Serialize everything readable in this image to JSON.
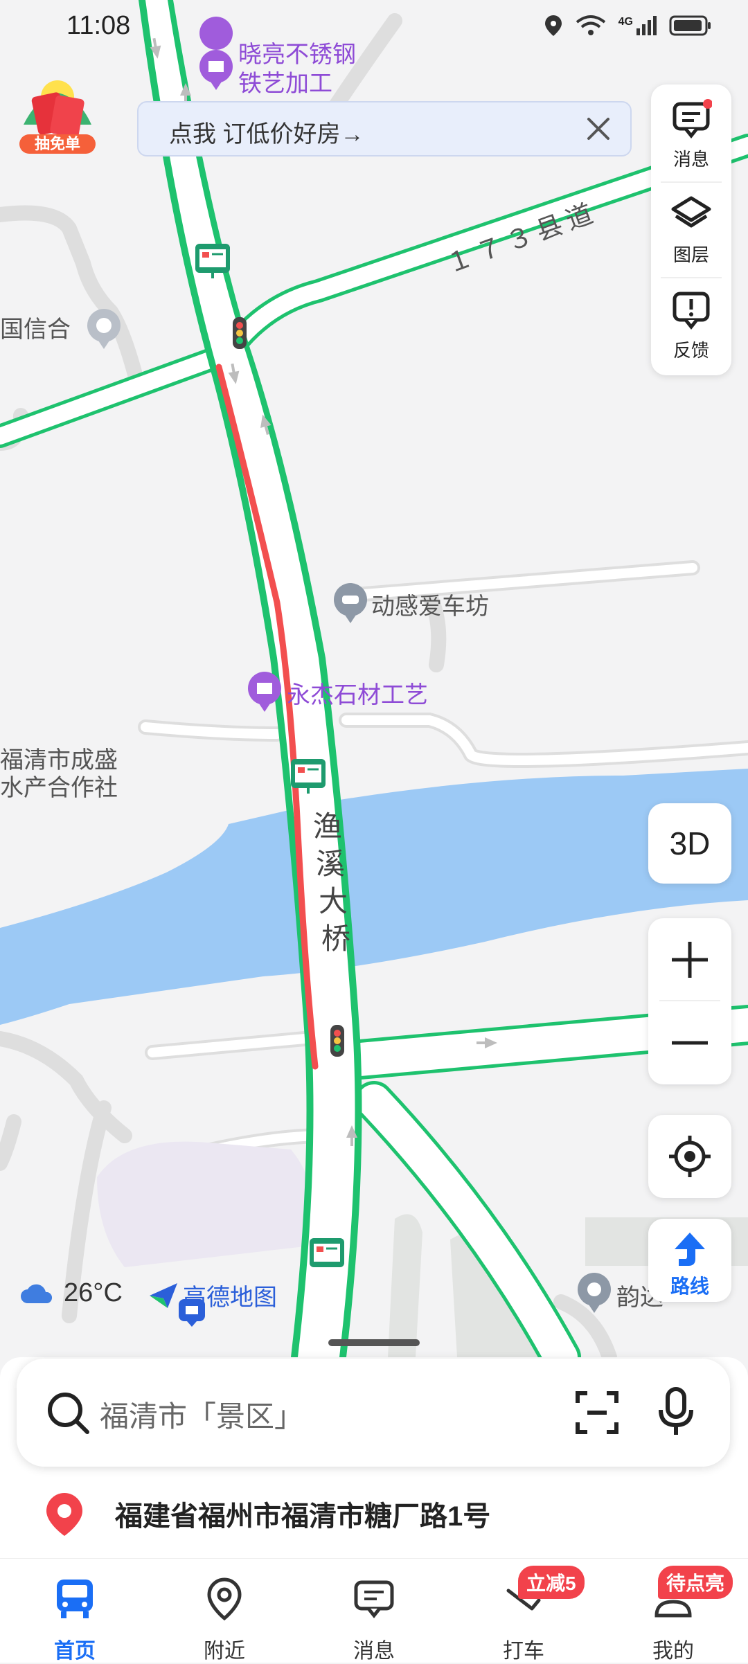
{
  "status": {
    "time": "11:08",
    "network": "4G"
  },
  "promo_badge": {
    "label": "抽免单"
  },
  "banner": {
    "text": "点我 订低价好房→"
  },
  "tools": [
    {
      "label": "消息",
      "icon": "message-icon"
    },
    {
      "label": "图层",
      "icon": "layers-icon"
    },
    {
      "label": "反馈",
      "icon": "feedback-icon"
    }
  ],
  "map": {
    "pois": {
      "xiaoliang": "晓亮不锈钢\n铁艺加工",
      "xinhe": "国信合",
      "dongan": "动感爱车坊",
      "yongjie": "永杰石材工艺",
      "chengsheng": "福清市成盛\n水产合作社",
      "yunda": "韵达"
    },
    "roads": {
      "county": "１７３县道",
      "bridge": "渔溪大桥"
    }
  },
  "controls": {
    "three_d": "3D",
    "route": "路线"
  },
  "weather": {
    "temp": "26°C"
  },
  "logo": {
    "text": "高德地图"
  },
  "search": {
    "placeholder": "福清市「景区」"
  },
  "location": {
    "address": "福建省福州市福清市糖厂路1号"
  },
  "tabs": [
    {
      "label": "首页",
      "icon": "bus-icon",
      "active": true
    },
    {
      "label": "附近",
      "icon": "location-pin-icon"
    },
    {
      "label": "消息",
      "icon": "message-icon"
    },
    {
      "label": "打车",
      "icon": "taxi-icon",
      "badge": "立减5"
    },
    {
      "label": "我的",
      "icon": "profile-icon",
      "badge": "待点亮"
    }
  ],
  "colors": {
    "accent": "#1a6ef5",
    "traffic_green": "#1ec26e",
    "traffic_red": "#f24f4f",
    "water": "#9cc9f5",
    "badge_red": "#f2424b"
  }
}
